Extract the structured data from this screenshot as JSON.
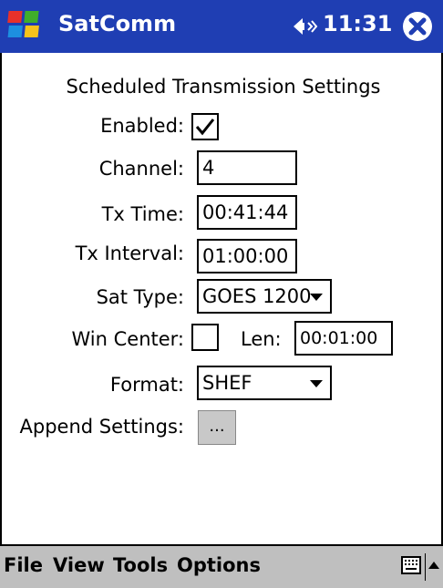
{
  "titlebar": {
    "app_name": "SatComm",
    "time": "11:31",
    "start_icon": "windows-flag-icon",
    "sound_icon": "speaker-icon",
    "close_icon": "close-icon"
  },
  "form": {
    "heading": "Scheduled Transmission Settings",
    "enabled": {
      "label": "Enabled:",
      "checked": true
    },
    "channel": {
      "label": "Channel:",
      "value": "4"
    },
    "tx_time": {
      "label": "Tx Time:",
      "value": "00:41:44"
    },
    "tx_interval": {
      "label": "Tx Interval:",
      "value": "01:00:00"
    },
    "sat_type": {
      "label": "Sat Type:",
      "value": "GOES 1200"
    },
    "win_center": {
      "label": "Win Center:",
      "checked": false
    },
    "len": {
      "label": "Len:",
      "value": "00:01:00"
    },
    "format": {
      "label": "Format:",
      "value": "SHEF"
    },
    "append": {
      "label": "Append Settings:",
      "button": "..."
    }
  },
  "menubar": {
    "items": [
      "File",
      "View",
      "Tools",
      "Options"
    ],
    "keyboard_icon": "keyboard-icon",
    "arrow_icon": "up-arrow-icon"
  },
  "colors": {
    "titlebar_bg": "#1f3eb3",
    "menubar_bg": "#bfbfbf"
  }
}
